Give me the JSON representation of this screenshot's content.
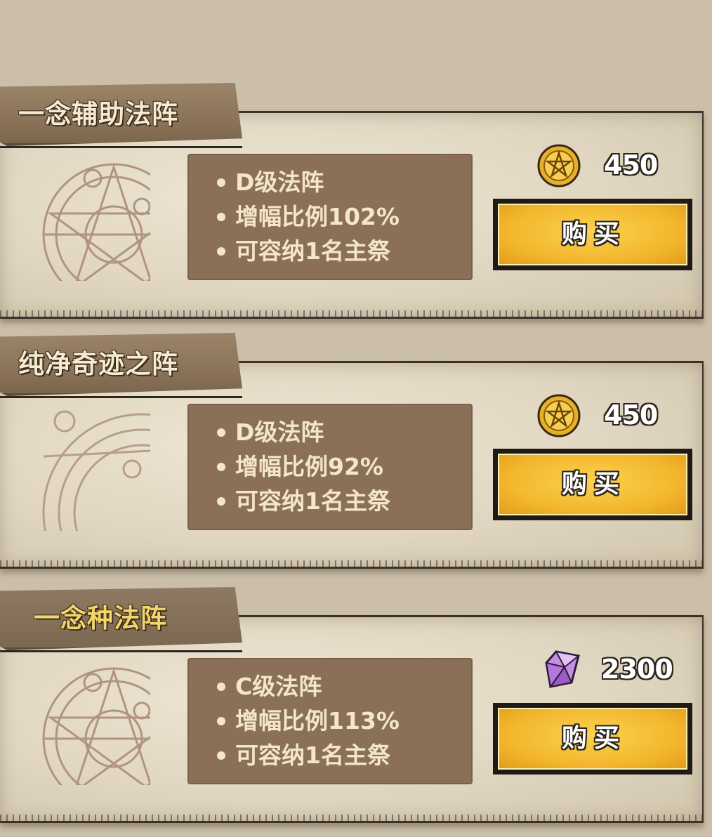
{
  "colors": {
    "panel": "#e0d6c1",
    "banner": "#8a7358",
    "desc_box": "#8a7058",
    "desc_text": "#f4e6c8",
    "buy_button": "#f2b62d",
    "outline": "#2b241d"
  },
  "formations": [
    {
      "name": "一念辅助法阵",
      "features": [
        "D级法阵",
        "增幅比例102%",
        "可容纳1名主祭"
      ],
      "currency_icon": "gold-coin-icon",
      "price": "450",
      "buy_label": "购买"
    },
    {
      "name": "纯净奇迹之阵",
      "features": [
        "D级法阵",
        "增幅比例92%",
        "可容纳1名主祭"
      ],
      "currency_icon": "gold-coin-icon",
      "price": "450",
      "buy_label": "购买"
    },
    {
      "name": "一念种法阵",
      "features": [
        "C级法阵",
        "增幅比例113%",
        "可容纳1名主祭"
      ],
      "currency_icon": "purple-crystal-icon",
      "price": "2300",
      "buy_label": "购买"
    }
  ]
}
